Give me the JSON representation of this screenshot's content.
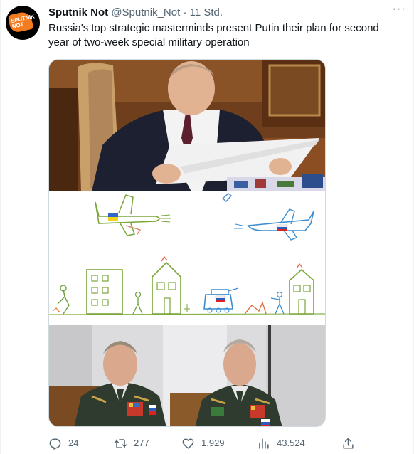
{
  "tweet": {
    "avatar_label": "SPUTNIK NOT",
    "name": "Sputnik Not",
    "handle": "@Sputnik_Not",
    "separator": "·",
    "time": "11 Std.",
    "more": "···",
    "text": "Russia's top strategic masterminds present Putin their plan for second year of two-week special military operation"
  },
  "actions": {
    "reply_count": "24",
    "retweet_count": "277",
    "like_count": "1.929",
    "views_count": "43.524"
  },
  "colors": {
    "text": "#0f1419",
    "secondary": "#536471",
    "avatar_accent": "#f47b20",
    "border": "#cfd9de"
  },
  "icons": [
    "reply-icon",
    "retweet-icon",
    "like-icon",
    "views-icon",
    "share-icon",
    "more-icon"
  ]
}
